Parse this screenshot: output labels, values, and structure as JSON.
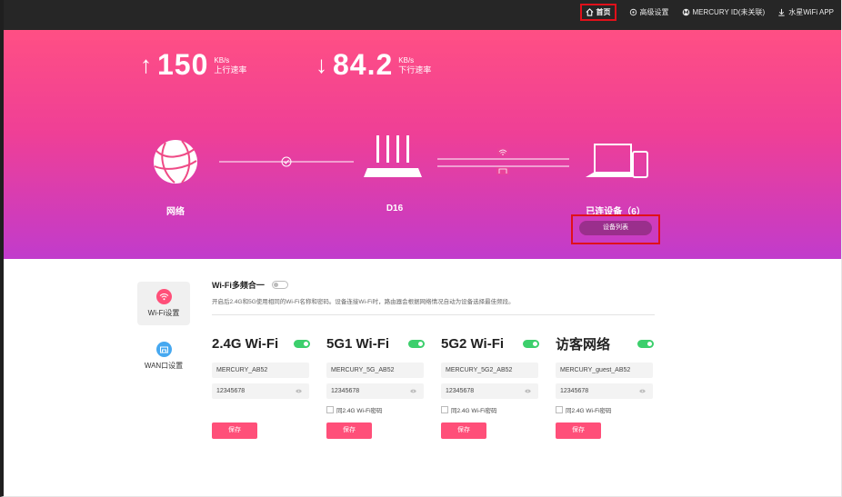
{
  "nav": {
    "items": [
      {
        "label": "首页",
        "icon": "home-icon",
        "active": true
      },
      {
        "label": "高级设置",
        "icon": "gear-icon"
      },
      {
        "label": "MERCURY ID(未关联)",
        "icon": "mercury-id-icon"
      },
      {
        "label": "水星WiFi APP",
        "icon": "download-icon"
      }
    ]
  },
  "hero": {
    "upload": {
      "value": "150",
      "unit": "KB/s",
      "label": "上行速率"
    },
    "download": {
      "value": "84.2",
      "unit": "KB/s",
      "label": "下行速率"
    },
    "network_label": "网络",
    "router_label": "D16",
    "devices_label": "已连设备（6）",
    "device_list_button": "设备列表"
  },
  "sidebar": {
    "items": [
      {
        "label": "Wi-Fi设置",
        "icon": "wifi-icon",
        "active": true
      },
      {
        "label": "WAN口设置",
        "icon": "wan-port-icon"
      }
    ]
  },
  "main": {
    "multi_band_label": "Wi-Fi多频合一",
    "multi_band_desc": "开启后2.4G和5G使用相同的Wi-Fi名称和密码。设备连接Wi-Fi时，路由器会根据网络情况自动为设备选择最佳频段。",
    "bands": [
      {
        "title": "2.4G Wi-Fi",
        "ssid": "MERCURY_AB52",
        "password": "12345678",
        "same_as_24g": "",
        "save": "保存"
      },
      {
        "title": "5G1 Wi-Fi",
        "ssid": "MERCURY_5G_AB52",
        "password": "12345678",
        "same_as_24g": "同2.4G Wi-Fi密码",
        "save": "保存"
      },
      {
        "title": "5G2 Wi-Fi",
        "ssid": "MERCURY_5G2_AB52",
        "password": "12345678",
        "same_as_24g": "同2.4G Wi-Fi密码",
        "save": "保存"
      },
      {
        "title": "访客网络",
        "ssid": "MERCURY_guest_AB52",
        "password": "12345678",
        "same_as_24g": "同2.4G Wi-Fi密码",
        "save": "保存"
      }
    ]
  },
  "colors": {
    "hero_top": "#ff4f84",
    "hero_bottom": "#c13bcc",
    "toggle_on": "#3ccf6c",
    "save_button": "#ff4f79",
    "highlight_border": "#e0101a"
  }
}
